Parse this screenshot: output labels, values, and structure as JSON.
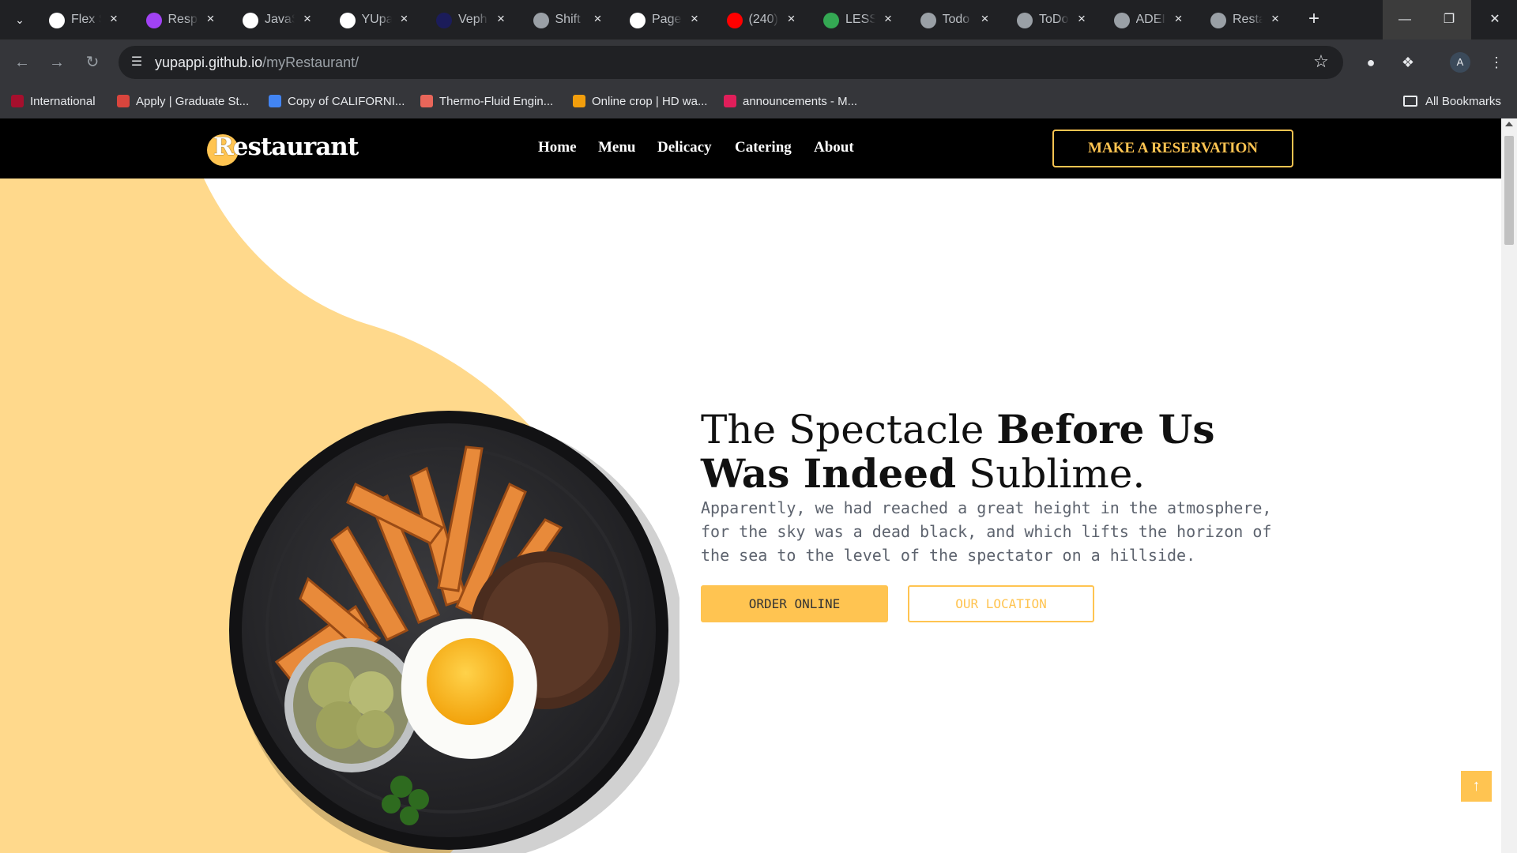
{
  "browser": {
    "tabs": [
      {
        "title": "Flex Sl",
        "icon": "openai-icon",
        "color": "#ffffff"
      },
      {
        "title": "Respo",
        "icon": "responsive-icon",
        "color": "#a142f4"
      },
      {
        "title": "JavaSc",
        "icon": "medium-icon",
        "color": "#ffffff"
      },
      {
        "title": "YUpa",
        "icon": "github-icon",
        "color": "#ffffff"
      },
      {
        "title": "Veph",
        "icon": "vephila-icon",
        "color": "#1b1c5a"
      },
      {
        "title": "Shift",
        "icon": "globe-icon",
        "color": "#9aa0a6"
      },
      {
        "title": "Page",
        "icon": "github-icon",
        "color": "#ffffff"
      },
      {
        "title": "(240)",
        "icon": "youtube-icon",
        "color": "#ff0000"
      },
      {
        "title": "LESS",
        "icon": "google-drive-icon",
        "color": "#34a853"
      },
      {
        "title": "Todo",
        "icon": "globe-icon",
        "color": "#9aa0a6"
      },
      {
        "title": "ToDo",
        "icon": "globe-icon",
        "color": "#9aa0a6"
      },
      {
        "title": "ADEI",
        "icon": "globe-icon",
        "color": "#9aa0a6"
      },
      {
        "title": "Resta",
        "icon": "globe-icon",
        "color": "#9aa0a6"
      }
    ],
    "url_host": "yupappi.github.io",
    "url_path": "/myRestaurant/",
    "profile_initial": "A",
    "bookmarks": [
      {
        "label": "International",
        "icon": "wsu-icon",
        "color": "#a60f2d"
      },
      {
        "label": "Apply | Graduate St...",
        "icon": "graduate-icon",
        "color": "#d9453d"
      },
      {
        "label": "Copy of CALIFORNI...",
        "icon": "google-docs-icon",
        "color": "#4285f4"
      },
      {
        "label": "Thermo-Fluid Engin...",
        "icon": "calendar-icon",
        "color": "#e8665a"
      },
      {
        "label": "Online crop | HD wa...",
        "icon": "flame-icon",
        "color": "#f29e0c"
      },
      {
        "label": "announcements - M...",
        "icon": "slack-icon",
        "color": "#e01e5a"
      }
    ],
    "all_bookmarks_label": "All Bookmarks"
  },
  "site": {
    "logo_text": "Restaurant",
    "nav": [
      "Home",
      "Menu",
      "Delicacy",
      "Catering",
      "About"
    ],
    "reserve_label": "MAKE A RESERVATION",
    "hero": {
      "title_light_1": "The Spectacle ",
      "title_bold_1": "Before Us",
      "title_bold_2": "Was Indeed",
      "title_light_2": " Sublime.",
      "description": "Apparently, we had reached a great height in the atmosphere, for the sky was a dead black, and which lifts the horizon of the sea to the level of the spectator on a hillside.",
      "order_label": "ORDER ONLINE",
      "location_label": "OUR LOCATION"
    },
    "accent_color": "#ffc451",
    "blob_color": "#ffd98c",
    "scroll_top_icon": "arrow-up-icon"
  }
}
